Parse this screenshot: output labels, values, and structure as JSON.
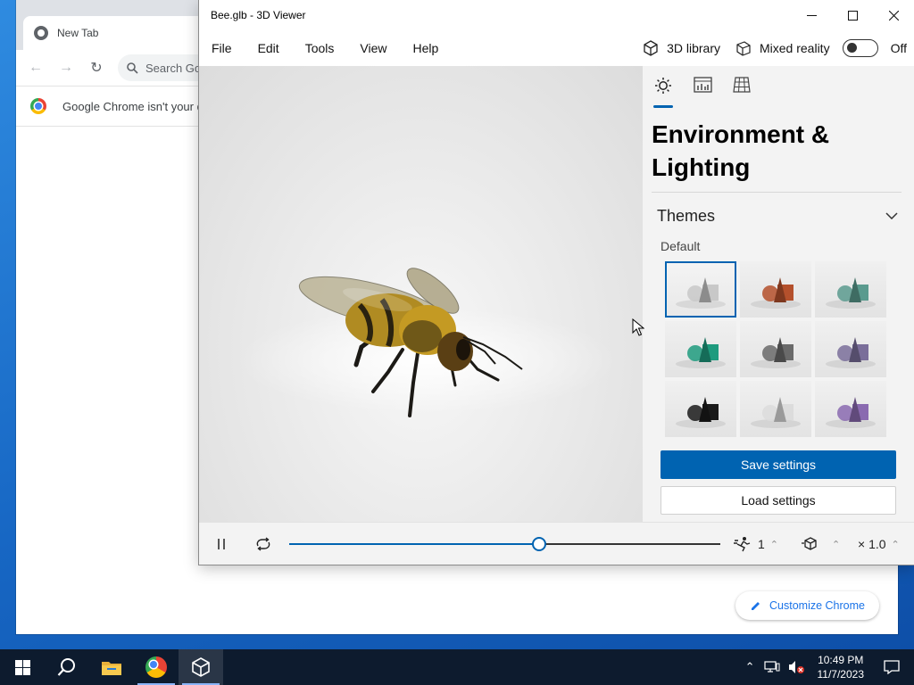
{
  "chrome": {
    "tab_title": "New Tab",
    "search_placeholder": "Search Go",
    "infobar_message": "Google Chrome isn't your d",
    "customize_label": "Customize Chrome"
  },
  "viewer": {
    "window_title": "Bee.glb - 3D Viewer",
    "menu": [
      "File",
      "Edit",
      "Tools",
      "View",
      "Help"
    ],
    "library_label": "3D library",
    "mixed_reality_label": "Mixed reality",
    "mixed_reality_state": "Off",
    "panel": {
      "tabs": [
        "environment-lighting-icon",
        "stats-shading-icon",
        "grid-icon"
      ],
      "title": "Environment & Lighting",
      "themes_label": "Themes",
      "default_label": "Default",
      "theme_colors": [
        "#c8c8c8",
        "#b4502c",
        "#5a9a8e",
        "#1e9b7e",
        "#6a6a6a",
        "#7a6e9a",
        "#1a1a1a",
        "#dcdcdc",
        "#8a6ab0"
      ],
      "selected_theme": 0,
      "save_label": "Save settings",
      "load_label": "Load settings"
    },
    "animation": {
      "progress": 0.58,
      "speed_value": "1",
      "scale_value": "× 1.0"
    }
  },
  "taskbar": {
    "time": "10:49 PM",
    "date": "11/7/2023"
  },
  "colors": {
    "accent": "#0063b1"
  }
}
